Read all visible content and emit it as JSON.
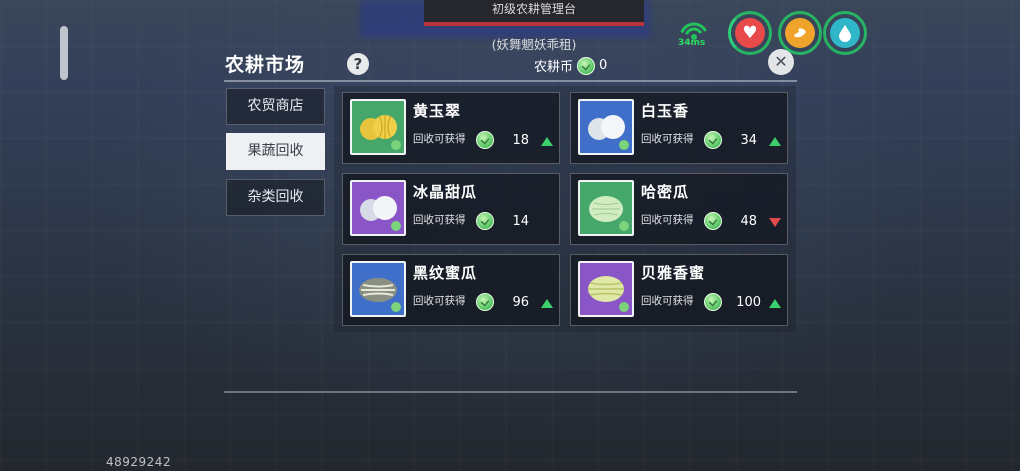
{
  "header": {
    "banner": "初级农耕管理台",
    "subtitle": "(妖舞魍妖乖租)",
    "ping": "34ms"
  },
  "panel": {
    "title": "农耕市场",
    "help": "?",
    "currency_label": "农耕币",
    "currency_value": "0",
    "close": "✕"
  },
  "tabs": [
    {
      "label": "农贸商店",
      "active": false
    },
    {
      "label": "果蔬回收",
      "active": true
    },
    {
      "label": "杂类回收",
      "active": false
    }
  ],
  "items": [
    {
      "name": "黄玉翠",
      "recv": "回收可获得",
      "price": "18",
      "trend": "up",
      "thumb_bg": "#45a86a"
    },
    {
      "name": "白玉香",
      "recv": "回收可获得",
      "price": "34",
      "trend": "up",
      "thumb_bg": "#3f6fc8"
    },
    {
      "name": "冰晶甜瓜",
      "recv": "回收可获得",
      "price": "14",
      "trend": "none",
      "thumb_bg": "#8a55c6"
    },
    {
      "name": "哈密瓜",
      "recv": "回收可获得",
      "price": "48",
      "trend": "down",
      "thumb_bg": "#45a86a"
    },
    {
      "name": "黑纹蜜瓜",
      "recv": "回收可获得",
      "price": "96",
      "trend": "up",
      "thumb_bg": "#3f6fc8"
    },
    {
      "name": "贝雅香蜜",
      "recv": "回收可获得",
      "price": "100",
      "trend": "up",
      "thumb_bg": "#8a55c6"
    }
  ],
  "footer": {
    "uid": "48929242"
  }
}
